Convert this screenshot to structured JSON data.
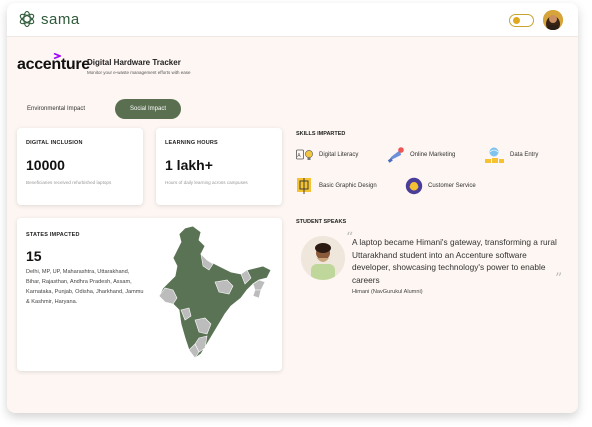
{
  "app": {
    "logo_text": "sama"
  },
  "header": {
    "brand": "accenture",
    "title": "Digital Hardware Tracker",
    "subtitle": "Monitor your e-waste management efforts with ease"
  },
  "tabs": [
    {
      "label": "Environmental Impact",
      "active": false
    },
    {
      "label": "Social Impact",
      "active": true
    }
  ],
  "metrics": {
    "digital_inclusion": {
      "label": "DIGITAL INCLUSION",
      "value": "10000",
      "desc": "Beneficiaries received refurbished laptops"
    },
    "learning_hours": {
      "label": "LEARNING HOURS",
      "value": "1 lakh+",
      "desc": "Hours of daily learning across campuses"
    }
  },
  "skills": {
    "label": "SKILLS IMPARTED",
    "items": [
      {
        "label": "Digital Literacy",
        "icon": "lightbulb-icon"
      },
      {
        "label": "Online Marketing",
        "icon": "megaphone-icon"
      },
      {
        "label": "Data Entry",
        "icon": "globe-icon"
      },
      {
        "label": "Basic Graphic Design",
        "icon": "palette-icon"
      },
      {
        "label": "Customer Service",
        "icon": "headset-icon"
      }
    ]
  },
  "states": {
    "label": "STATES IMPACTED",
    "value": "15",
    "list": "Delhi, MP, UP, Maharashtra, Uttarakhand, Bihar, Rajasthan, Andhra Pradesh, Assam, Karnataka, Punjab, Odisha, Jharkhand, Jammu & Kashmir, Haryana."
  },
  "student": {
    "label": "STUDENT SPEAKS",
    "quote": "A laptop became Himani's gateway, transforming a rural Uttarakhand student into an Accenture software developer, showcasing technology's power to enable careers",
    "author": "Himani (NavGurukul Alumni)"
  },
  "colors": {
    "accent": "#5a6f50",
    "map_impacted": "#5a7355",
    "map_other": "#bcbcbc",
    "background": "#fdf6f2"
  }
}
